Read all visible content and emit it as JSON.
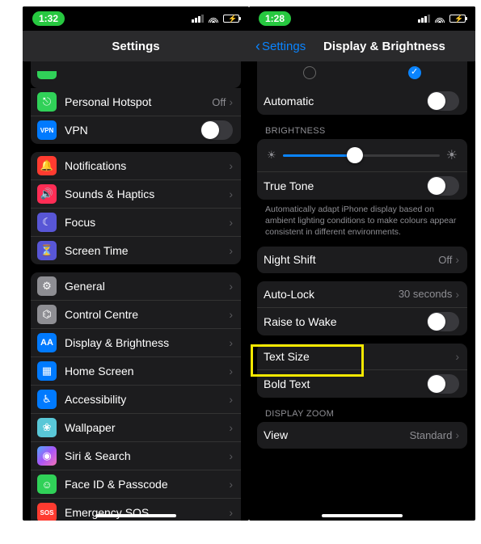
{
  "left": {
    "status_time": "1:32",
    "title": "Settings",
    "top_group": [
      {
        "icon": "link-icon",
        "bg": "bg-green",
        "glyph": "⎋",
        "label": "Personal Hotspot",
        "value": "Off",
        "type": "nav"
      },
      {
        "icon": "vpn-icon",
        "bg": "bg-blue",
        "glyph": "VPN",
        "label": "VPN",
        "type": "toggle",
        "on": false
      }
    ],
    "group2": [
      {
        "icon": "bell-icon",
        "bg": "bg-red",
        "glyph": "🔔",
        "label": "Notifications"
      },
      {
        "icon": "speaker-icon",
        "bg": "bg-redp",
        "glyph": "🔊",
        "label": "Sounds & Haptics"
      },
      {
        "icon": "moon-icon",
        "bg": "bg-indigo",
        "glyph": "☾",
        "label": "Focus"
      },
      {
        "icon": "hourglass-icon",
        "bg": "bg-indigo",
        "glyph": "⏳",
        "label": "Screen Time"
      }
    ],
    "group3": [
      {
        "icon": "gear-icon",
        "bg": "bg-gray",
        "glyph": "⚙",
        "label": "General"
      },
      {
        "icon": "switches-icon",
        "bg": "bg-gray",
        "glyph": "⌬",
        "label": "Control Centre"
      },
      {
        "icon": "aa-icon",
        "bg": "bg-blue",
        "glyph": "AA",
        "label": "Display & Brightness"
      },
      {
        "icon": "grid-icon",
        "bg": "bg-blue",
        "glyph": "▦",
        "label": "Home Screen"
      },
      {
        "icon": "person-icon",
        "bg": "bg-blue",
        "glyph": "♿︎",
        "label": "Accessibility"
      },
      {
        "icon": "flower-icon",
        "bg": "bg-teal",
        "glyph": "❀",
        "label": "Wallpaper"
      },
      {
        "icon": "siri-icon",
        "bg": "bg-siri",
        "glyph": "◉",
        "label": "Siri & Search"
      },
      {
        "icon": "faceid-icon",
        "bg": "bg-green",
        "glyph": "☺",
        "label": "Face ID & Passcode"
      },
      {
        "icon": "sos-icon",
        "bg": "bg-red",
        "glyph": "SOS",
        "label": "Emergency SOS"
      }
    ]
  },
  "right": {
    "status_time": "1:28",
    "back_label": "Settings",
    "title": "Display & Brightness",
    "automatic": {
      "label": "Automatic",
      "on": false
    },
    "brightness_section": "Brightness",
    "brightness_pct": 46,
    "true_tone": {
      "label": "True Tone",
      "on": false
    },
    "true_tone_footnote": "Automatically adapt iPhone display based on ambient lighting conditions to make colours appear consistent in different environments.",
    "night_shift": {
      "label": "Night Shift",
      "value": "Off"
    },
    "auto_lock": {
      "label": "Auto-Lock",
      "value": "30 seconds"
    },
    "raise_to_wake": {
      "label": "Raise to Wake",
      "on": false
    },
    "text_size": {
      "label": "Text Size"
    },
    "bold_text": {
      "label": "Bold Text",
      "on": false
    },
    "zoom_section": "Display Zoom",
    "view": {
      "label": "View",
      "value": "Standard"
    }
  }
}
